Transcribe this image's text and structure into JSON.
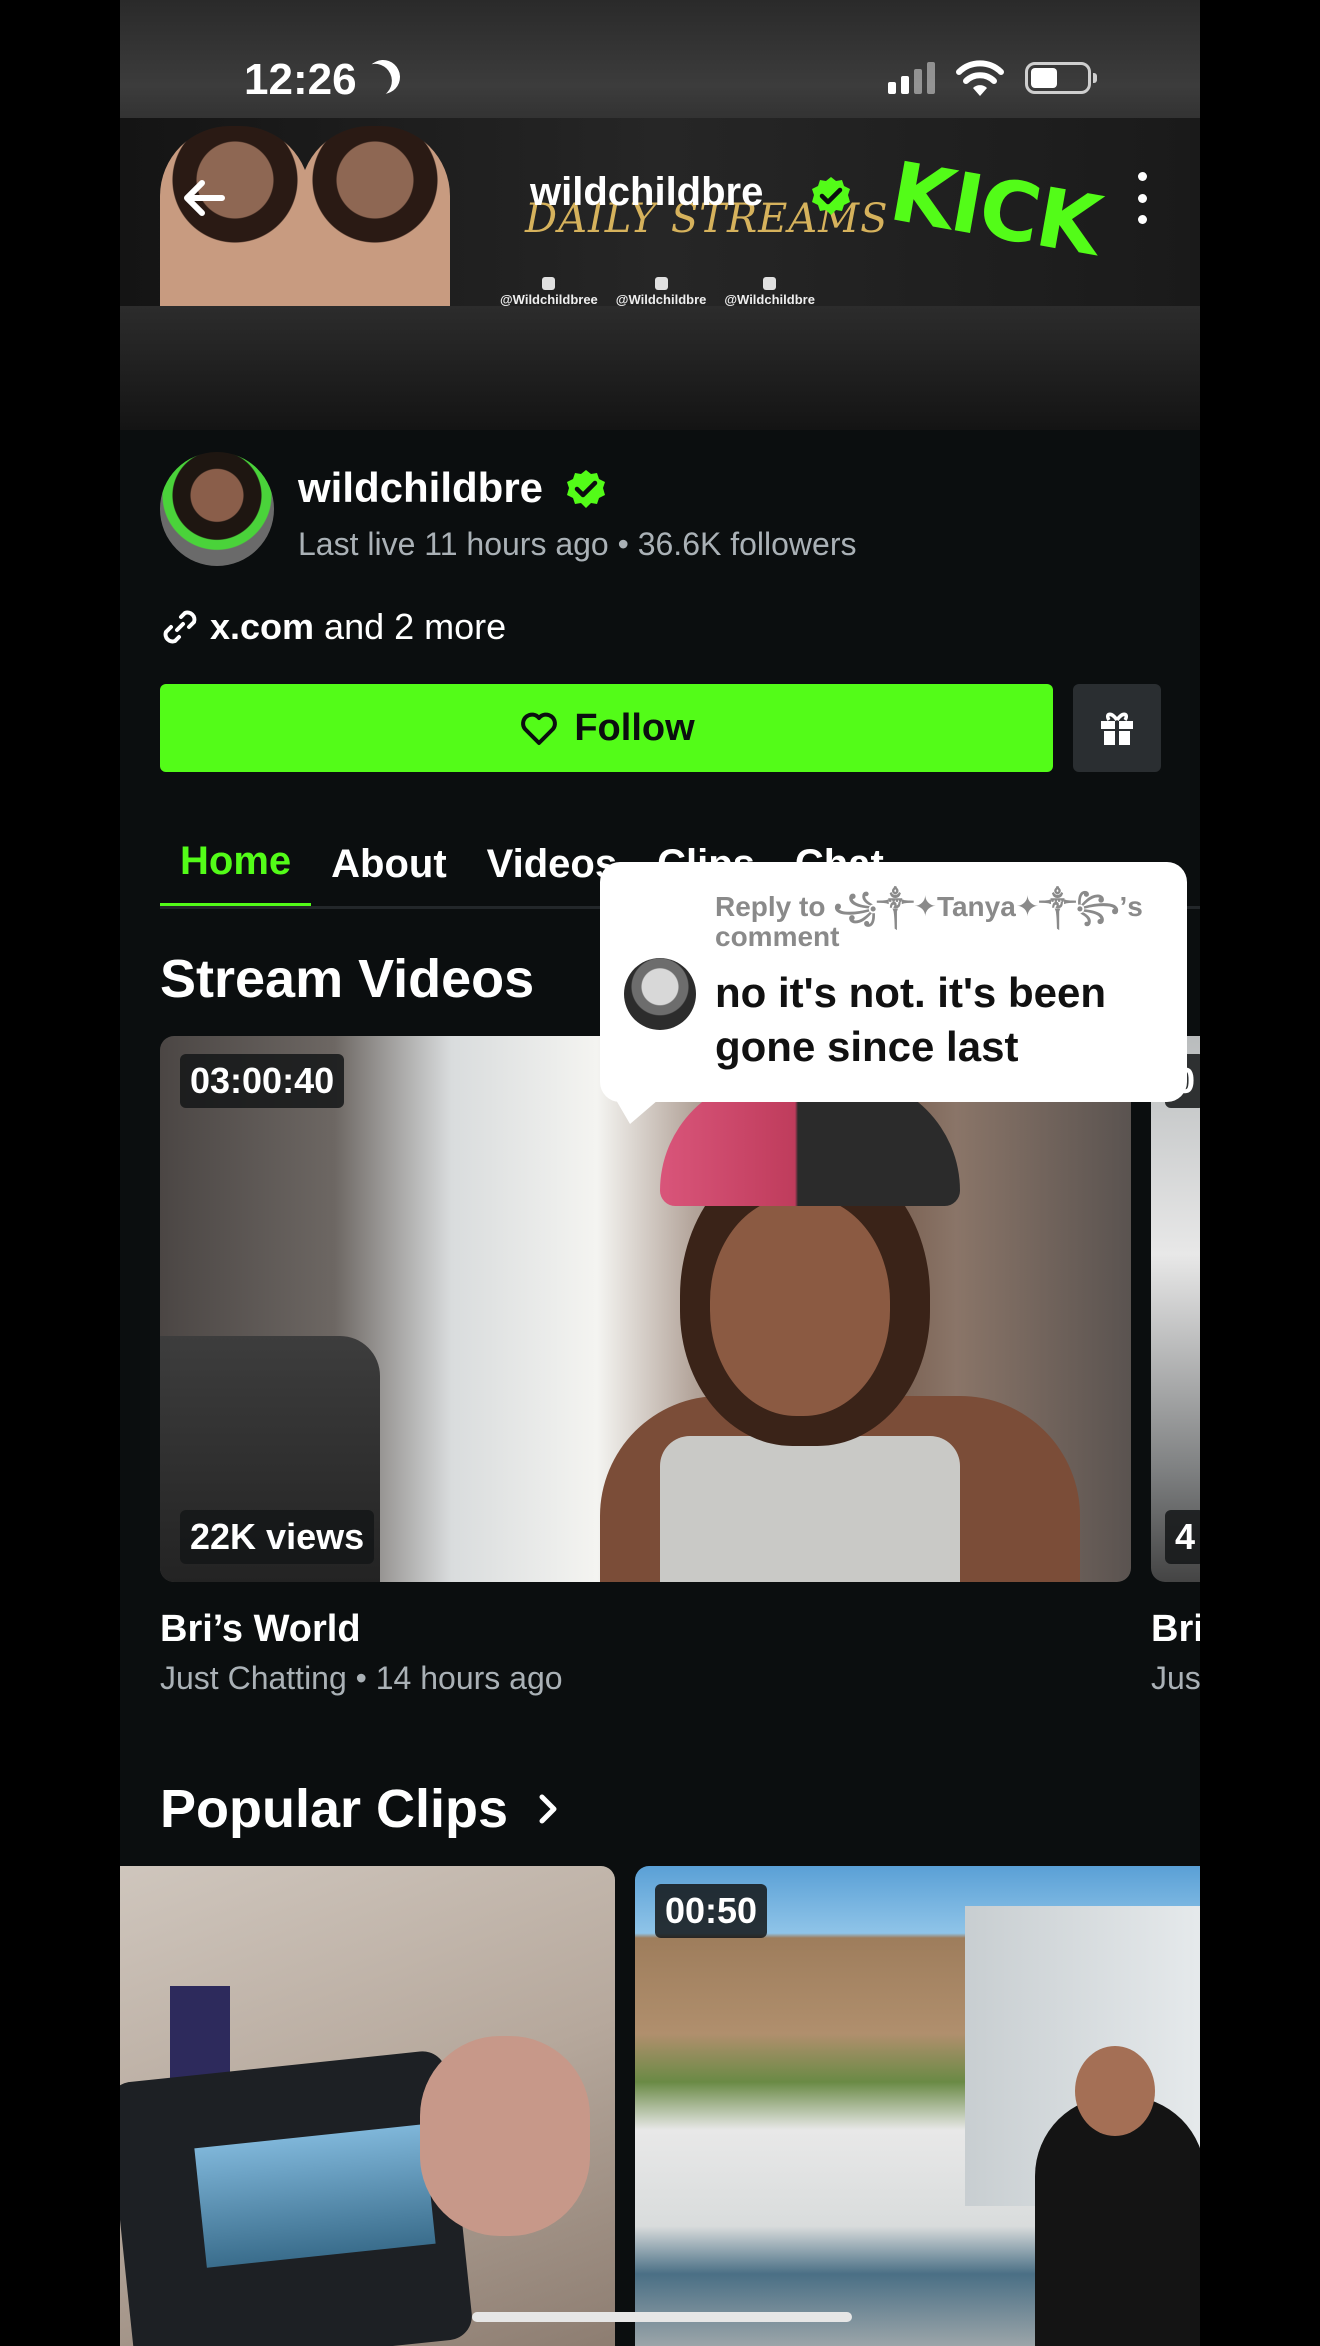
{
  "status_bar": {
    "time": "12:26"
  },
  "banner": {
    "script_text": "DAILY STREAMS",
    "handles": [
      "@Wildchildbree",
      "@Wildchildbre",
      "@Wildchildbre"
    ],
    "kick_logo": "KICK"
  },
  "header": {
    "title": "wildchildbre"
  },
  "profile": {
    "name": "wildchildbre",
    "meta": "Last live 11 hours ago • 36.6K followers",
    "links_main": "x.com",
    "links_more": " and 2 more",
    "follow_label": "Follow"
  },
  "tabs": [
    "Home",
    "About",
    "Videos",
    "Clips",
    "Chat"
  ],
  "sections": {
    "stream_videos": "Stream Videos",
    "popular_clips": "Popular Clips"
  },
  "videos": [
    {
      "duration": "03:00:40",
      "views": "22K views",
      "title": "Bri’s World",
      "subtitle": "Just Chatting • 14 hours ago"
    },
    {
      "duration": "0",
      "views": "4",
      "title": "Bri",
      "subtitle": "Jus"
    }
  ],
  "clips": [
    {
      "duration": ""
    },
    {
      "duration": "00:50"
    }
  ],
  "reply_overlay": {
    "reply_to": "Reply to ꧁༒✦Tanya✦༒꧂’s comment",
    "text": "no it's not. it's been gone since last"
  },
  "colors": {
    "accent": "#53fc18",
    "background": "#0b0e0f",
    "muted_text": "#aab1b6"
  }
}
